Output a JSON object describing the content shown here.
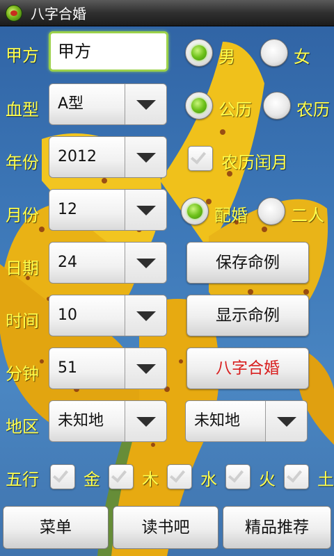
{
  "app": {
    "title": "八字合婚"
  },
  "form": {
    "name_label": "甲方",
    "name_value": "甲方",
    "gender": {
      "male": "男",
      "female": "女",
      "selected": "male"
    },
    "blood_label": "血型",
    "blood_value": "A型",
    "calendar": {
      "solar": "公历",
      "lunar": "农历",
      "selected": "solar"
    },
    "year_label": "年份",
    "year_value": "2012",
    "leap_month_label": "农历闰月",
    "leap_month_checked": false,
    "month_label": "月份",
    "month_value": "12",
    "mode": {
      "match": "配婚",
      "two": "二人",
      "selected": "match"
    },
    "day_label": "日期",
    "day_value": "24",
    "save_button": "保存命例",
    "hour_label": "时间",
    "hour_value": "10",
    "show_button": "显示命例",
    "minute_label": "分钟",
    "minute_value": "51",
    "match_button": "八字合婚",
    "region_label": "地区",
    "region_value_1": "未知地",
    "region_value_2": "未知地",
    "elements_label": "五行",
    "elements": [
      "金",
      "木",
      "水",
      "火",
      "土"
    ]
  },
  "bottom_bar": {
    "menu": "菜单",
    "reading": "读书吧",
    "recommend": "精品推荐"
  },
  "colors": {
    "label_yellow": "#ffff4d",
    "radio_green": "#6fc21b",
    "red_text": "#d81e1e"
  }
}
